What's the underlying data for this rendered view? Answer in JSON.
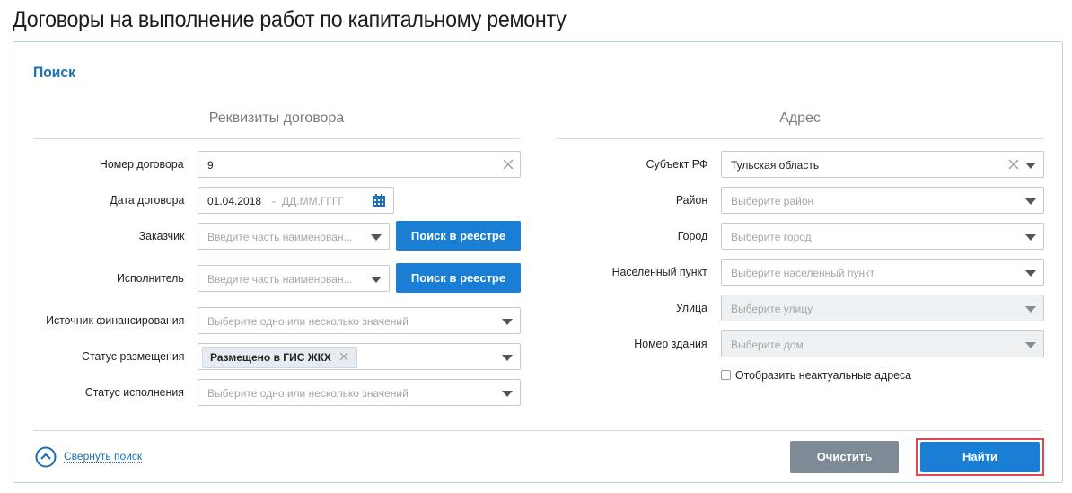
{
  "page": {
    "title": "Договоры на выполнение работ по капитальному ремонту"
  },
  "search": {
    "title": "Поиск",
    "contract_section": {
      "title": "Реквизиты договора",
      "contract_number": {
        "label": "Номер договора",
        "value": "9"
      },
      "contract_date": {
        "label": "Дата договора",
        "from_value": "01.04.2018",
        "separator": "-",
        "to_placeholder": "ДД.ММ.ГГГГ"
      },
      "customer": {
        "label": "Заказчик",
        "placeholder": "Введите часть наименован...",
        "button": "Поиск в реестре"
      },
      "executor": {
        "label": "Исполнитель",
        "placeholder": "Введите часть наименован...",
        "button": "Поиск в реестре"
      },
      "funding_source": {
        "label": "Источник финансирования",
        "placeholder": "Выберите одно или несколько значений"
      },
      "placement_status": {
        "label": "Статус размещения",
        "chip": "Размещено в ГИС ЖКХ"
      },
      "execution_status": {
        "label": "Статус исполнения",
        "placeholder": "Выберите одно или несколько значений"
      }
    },
    "address_section": {
      "title": "Адрес",
      "subject": {
        "label": "Субъект РФ",
        "value": "Тульская область"
      },
      "district": {
        "label": "Район",
        "placeholder": "Выберите район"
      },
      "city": {
        "label": "Город",
        "placeholder": "Выберите город"
      },
      "settlement": {
        "label": "Населенный пункт",
        "placeholder": "Выберите населенный пункт"
      },
      "street": {
        "label": "Улица",
        "placeholder": "Выберите улицу"
      },
      "building": {
        "label": "Номер здания",
        "placeholder": "Выберите дом"
      },
      "show_outdated": {
        "label": "Отобразить неактуальные адреса",
        "checked": false
      }
    },
    "footer": {
      "collapse_label": "Свернуть поиск",
      "clear_button": "Очистить",
      "find_button": "Найти"
    }
  },
  "colors": {
    "accent": "#1a7fd4",
    "title_blue": "#1b6fb3",
    "clear_button": "#7e8a96",
    "highlight": "#e0464f"
  },
  "icons": [
    "clear-x-icon",
    "calendar-icon",
    "chevron-down-icon",
    "chevron-up-circle-icon"
  ]
}
